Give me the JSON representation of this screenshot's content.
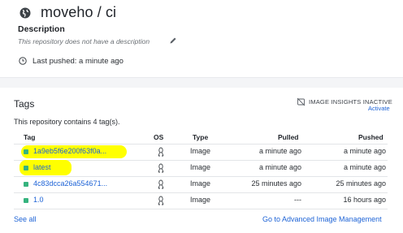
{
  "repo": {
    "title": "moveho / ci",
    "description_heading": "Description",
    "description_text": "This repository does not have a description",
    "last_pushed": "Last pushed: a minute ago"
  },
  "tags": {
    "title": "Tags",
    "insights_label": "IMAGE INSIGHTS INACTIVE",
    "activate_label": "Activate",
    "count_text": "This repository contains 4 tag(s).",
    "columns": [
      "Tag",
      "OS",
      "Type",
      "Pulled",
      "Pushed"
    ],
    "rows": [
      {
        "tag": "1a9eb5f6e200f63f0a...",
        "os_icon": "linux-icon",
        "type": "Image",
        "pulled": "a minute ago",
        "pushed": "a minute ago",
        "highlighted": true
      },
      {
        "tag": "latest",
        "os_icon": "linux-icon",
        "type": "Image",
        "pulled": "a minute ago",
        "pushed": "a minute ago",
        "highlighted": true
      },
      {
        "tag": "4c83dcca26a554671...",
        "os_icon": "linux-icon",
        "type": "Image",
        "pulled": "25 minutes ago",
        "pushed": "25 minutes ago",
        "highlighted": false
      },
      {
        "tag": "1.0",
        "os_icon": "linux-icon",
        "type": "Image",
        "pulled": "---",
        "pushed": "16 hours ago",
        "highlighted": false
      }
    ],
    "see_all": "See all",
    "advanced_link": "Go to Advanced Image Management"
  },
  "colors": {
    "link": "#1d63d6",
    "tag_marker": "#36b37e",
    "highlight": "#ffff00"
  }
}
